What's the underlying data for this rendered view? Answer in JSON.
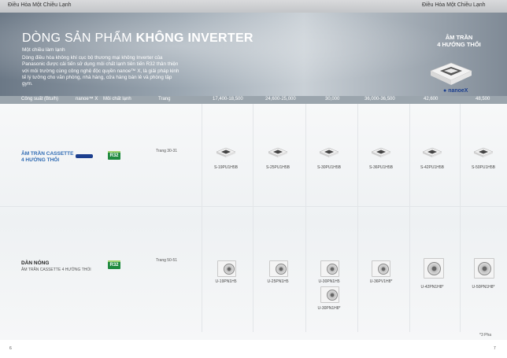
{
  "header": {
    "left_title": "Điều Hòa Một Chiều Lạnh",
    "right_title": "Điều Hòa Một Chiều Lạnh"
  },
  "hero": {
    "title_light": "DÒNG SẢN PHẨM ",
    "title_bold": "KHÔNG INVERTER",
    "subtitle": "Một chiều làm lạnh",
    "description": "Dòng điều hòa không khí cục bộ thương mại không Inverter của Panasonic được cải tiến sử dụng môi chất lạnh tiên tiến R32 thân thiện với môi trường cùng công nghệ độc quyền nanoe™ X, là giải pháp kinh tế lý tưởng cho văn phòng, nhà hàng, cửa hàng bán lẻ và phòng tập gym.",
    "badge_line1": "ÂM TRẦN",
    "badge_line2": "4 HƯỚNG THỔI",
    "nanoe_logo": "nanoeX"
  },
  "table": {
    "headers": [
      "Công suất (Btu/h)",
      "nanoe™ X",
      "Môi chất lạnh",
      "Trang",
      "17,400-18,500",
      "24,600-25,000",
      "30,000",
      "36,000-36,500",
      "42,600",
      "48,500"
    ],
    "rows": [
      {
        "name_line1": "ÂM TRẦN CASSETTE",
        "name_line2": "4 HƯỚNG THỔI",
        "sub": "",
        "refrigerant": "R32",
        "page": "Trang 30-31",
        "models": [
          "S-19PU1H5B",
          "S-25PU1H5B",
          "S-30PU1H5B",
          "S-36PU1H5B",
          "S-42PU1H5B",
          "S-50PU1H5B"
        ]
      },
      {
        "name_line1": "DÀN NÓNG",
        "name_line2": "",
        "sub": "ÂM TRẦN CASSETTE 4 HƯỚNG THỔI",
        "refrigerant": "R32",
        "page": "Trang 50-51",
        "models": [
          "U-19PN1H5",
          "U-25PN1H5",
          "U-30PN1H5",
          "U-36PV1H8*",
          "U-42PN1H8*",
          "U-50PN1H8*"
        ],
        "extra_model": "U-30PN1H8*"
      }
    ]
  },
  "footer": {
    "footnote": "*3 Pha",
    "page_left": "6",
    "page_right": "7"
  }
}
